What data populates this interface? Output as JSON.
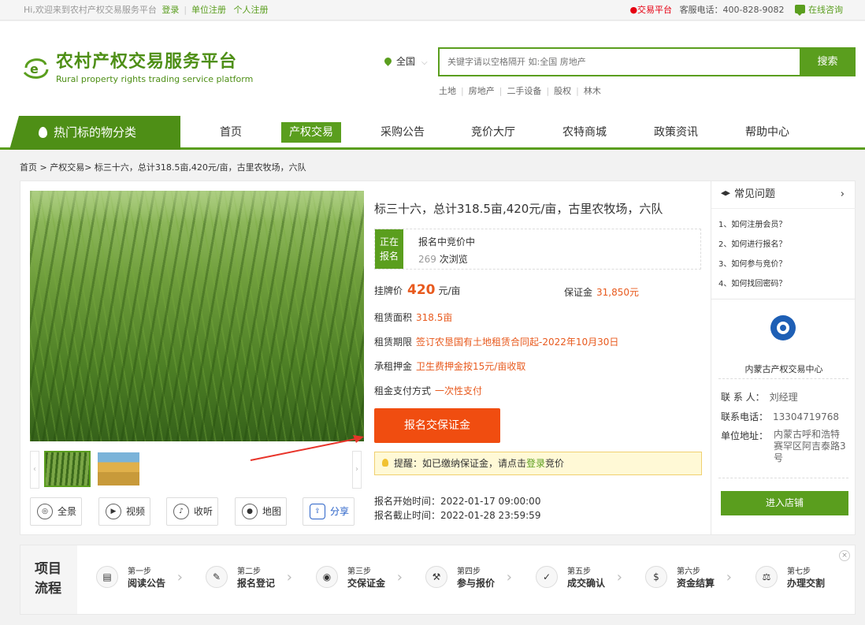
{
  "topbar": {
    "welcome": "Hi,欢迎来到农村产权交易服务平台",
    "login": "登录",
    "unit_register": "单位注册",
    "personal_register": "个人注册",
    "trading_platform": "●交易平台",
    "hotline": "客服电话：400-828-9082",
    "online_consult": "在线咨询"
  },
  "logo": {
    "title": "农村产权交易服务平台",
    "subtitle": "Rural property rights trading service platform"
  },
  "search": {
    "region": "全国",
    "placeholder": "关键字请以空格隔开 如:全国 房地产",
    "button": "搜索",
    "hot": [
      "土地",
      "房地产",
      "二手设备",
      "股权",
      "林木"
    ]
  },
  "nav": {
    "category": "热门标的物分类",
    "items": [
      "首页",
      "产权交易",
      "采购公告",
      "竞价大厅",
      "农特商城",
      "政策资讯",
      "帮助中心"
    ]
  },
  "breadcrumb": "首页 > 产权交易> 标三十六，总计318.5亩,420元/亩，古里农牧场，六队",
  "listing": {
    "title": "标三十六，总计318.5亩,420元/亩，古里农牧场，六队",
    "status_tag": "正在报名",
    "status_text": "报名中竞价中",
    "views_num": "269",
    "views_unit": "次浏览",
    "price_label": "挂牌价",
    "price_value": "420",
    "price_unit": "元/亩",
    "deposit_label": "保证金",
    "deposit_value": "31,850元",
    "area_label": "租赁面积",
    "area_value": "318.5亩",
    "term_label": "租赁期限",
    "term_value": "签订农垦国有土地租赁合同起-2022年10月30日",
    "rent_deposit_label": "承租押金",
    "rent_deposit_value": "卫生费押金按15元/亩收取",
    "payment_label": "租金支付方式",
    "payment_value": "一次性支付",
    "signup_button": "报名交保证金",
    "notice_prefix": "提醒：如已缴纳保证金，请点击",
    "notice_link": "登录",
    "notice_suffix": "竞价",
    "start_time": "报名开始时间：2022-01-17 09:00:00",
    "end_time": "报名截止时间：2022-01-28 23:59:59"
  },
  "tools": [
    "全景",
    "视频",
    "收听",
    "地图",
    "分享"
  ],
  "faq": {
    "title": "常见问题",
    "more": "›",
    "items": [
      "1、如何注册会员？",
      "2、如何进行报名？",
      "3、如何参与竞价？",
      "4、如何找回密码？"
    ]
  },
  "org": {
    "name": "内蒙古产权交易中心",
    "contact_label": "联 系 人：",
    "contact_value": "刘经理",
    "phone_label": "联系电话：",
    "phone_value": "13304719768",
    "address_label": "单位地址：",
    "address_value": "内蒙古呼和浩特赛罕区阿吉泰路3号",
    "shop_button": "进入店铺"
  },
  "flow": {
    "label_line1": "项目",
    "label_line2": "流程",
    "close": "×",
    "steps": [
      {
        "n": "第一步",
        "t": "阅读公告",
        "icon": "document-icon"
      },
      {
        "n": "第二步",
        "t": "报名登记",
        "icon": "edit-icon"
      },
      {
        "n": "第三步",
        "t": "交保证金",
        "icon": "coins-icon"
      },
      {
        "n": "第四步",
        "t": "参与报价",
        "icon": "gavel-icon"
      },
      {
        "n": "第五步",
        "t": "成交确认",
        "icon": "check-icon"
      },
      {
        "n": "第六步",
        "t": "资金结算",
        "icon": "money-bag-icon"
      },
      {
        "n": "第七步",
        "t": "办理交割",
        "icon": "scale-icon"
      }
    ]
  }
}
